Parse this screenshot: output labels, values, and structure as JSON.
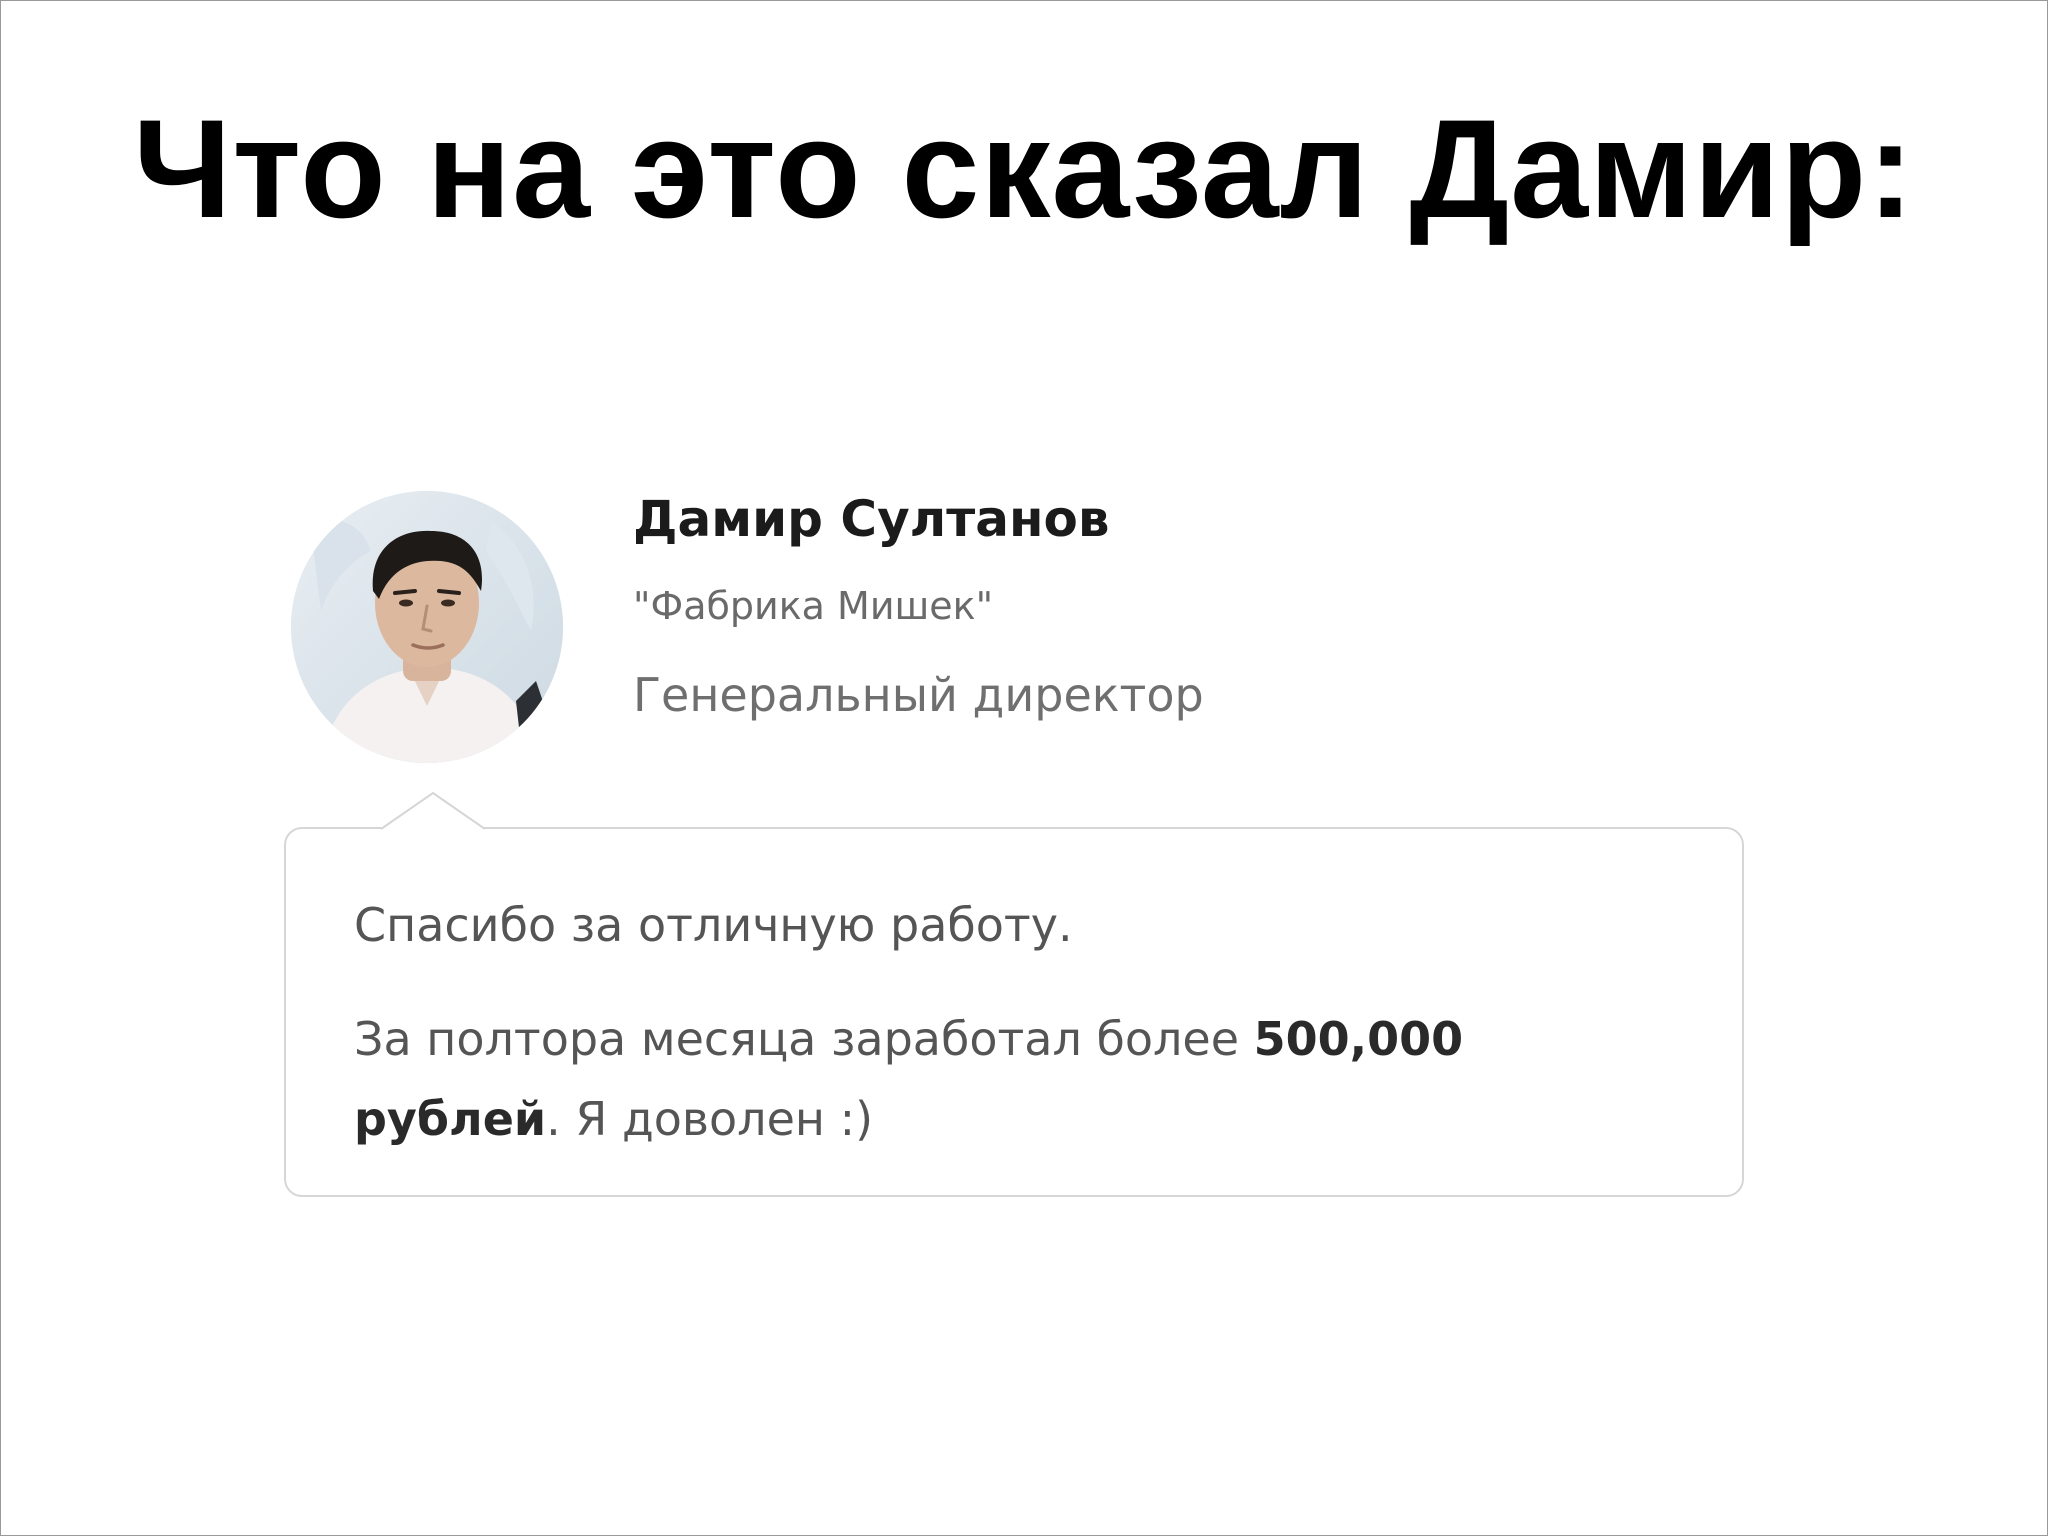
{
  "slide": {
    "title": "Что на это сказал Дамир:"
  },
  "testimonial": {
    "name": "Дамир Султанов",
    "company": "\"Фабрика Мишек\"",
    "position": "Генеральный директор",
    "message_line1": "Спасибо за отличную работу.",
    "message_line2_prefix": "За полтора месяца заработал более ",
    "message_line2_amount": "500,000 рублей",
    "message_line2_suffix": ". Я доволен :)"
  }
}
